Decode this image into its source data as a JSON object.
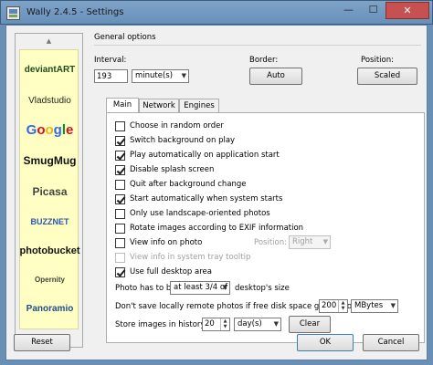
{
  "window": {
    "title": "Wally 2.4.5 - Settings",
    "controls": {
      "minimize": "—",
      "maximize": "☐",
      "close": "✕"
    }
  },
  "sidebar": {
    "scroll_up": "▲",
    "scroll_down": "▼",
    "logos": [
      "deviantART",
      "Vladstudio",
      "Google",
      "SmugMug",
      "Picasa",
      "BUZZNET",
      "photobucket",
      "Opernity",
      "Panoramio"
    ],
    "logo_icons": [
      "deviantart-icon",
      "vladstudio-icon",
      "google-icon",
      "smugmug-icon",
      "picasa-icon",
      "buzznet-icon",
      "photobucket-icon",
      "opernity-icon",
      "panoramio-icon"
    ]
  },
  "general": {
    "title": "General options",
    "interval_label": "Interval:",
    "interval_value": "193",
    "interval_unit": "minute(s)",
    "border_label": "Border:",
    "border_value": "Auto",
    "position_label": "Position:",
    "position_value": "Scaled"
  },
  "tabs": [
    {
      "label": "Main",
      "active": true
    },
    {
      "label": "Network",
      "active": false
    },
    {
      "label": "Engines",
      "active": false
    }
  ],
  "main": {
    "options": [
      {
        "label": "Choose in random order",
        "checked": false,
        "disabled": false
      },
      {
        "label": "Switch background on play",
        "checked": true,
        "disabled": false
      },
      {
        "label": "Play automatically on application start",
        "checked": true,
        "disabled": false
      },
      {
        "label": "Disable splash screen",
        "checked": true,
        "disabled": false
      },
      {
        "label": "Quit after background change",
        "checked": false,
        "disabled": false
      },
      {
        "label": "Start automatically when system starts",
        "checked": true,
        "disabled": false
      },
      {
        "label": "Only use landscape-oriented photos",
        "checked": false,
        "disabled": false
      },
      {
        "label": "Rotate images according to EXIF information",
        "checked": false,
        "disabled": false
      },
      {
        "label": "View info on photo",
        "checked": false,
        "disabled": false
      },
      {
        "label": "View info in system tray tooltip",
        "checked": false,
        "disabled": true
      },
      {
        "label": "Use full desktop area",
        "checked": true,
        "disabled": false
      }
    ],
    "info_position_label": "Position:",
    "info_position_value": "Right",
    "photo_size_prefix": "Photo has to be",
    "photo_size_value": "at least 3/4 of",
    "photo_size_suffix": "desktop's size",
    "disk_space_prefix": "Don't save locally remote photos if free disk space goes below",
    "disk_space_value": "200",
    "disk_space_unit": "MBytes",
    "history_prefix": "Store images in history for",
    "history_value": "20",
    "history_unit": "day(s)",
    "clear_label": "Clear"
  },
  "footer": {
    "reset_label": "Reset",
    "ok_label": "OK",
    "cancel_label": "Cancel"
  }
}
